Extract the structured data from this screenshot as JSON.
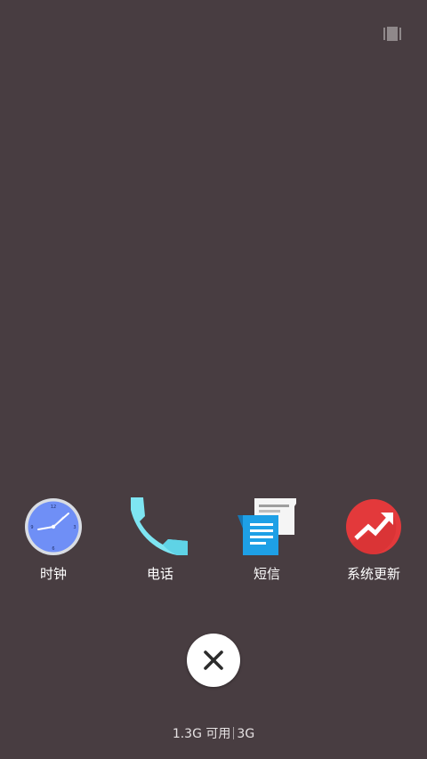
{
  "top_bar": {
    "icon": "multi-window-icon"
  },
  "apps": [
    {
      "label": "时钟",
      "icon": "clock-icon"
    },
    {
      "label": "电话",
      "icon": "phone-icon"
    },
    {
      "label": "短信",
      "icon": "messages-icon"
    },
    {
      "label": "系统更新",
      "icon": "system-update-icon"
    }
  ],
  "close": {
    "icon": "close-icon"
  },
  "status": {
    "available": "1.3G 可用",
    "total": "3G"
  },
  "colors": {
    "background": "#483d41",
    "clock_face": "#6f8ff6",
    "phone": "#7ee5f2",
    "messages_blue": "#1ea0e6",
    "update_red": "#e3393b"
  }
}
